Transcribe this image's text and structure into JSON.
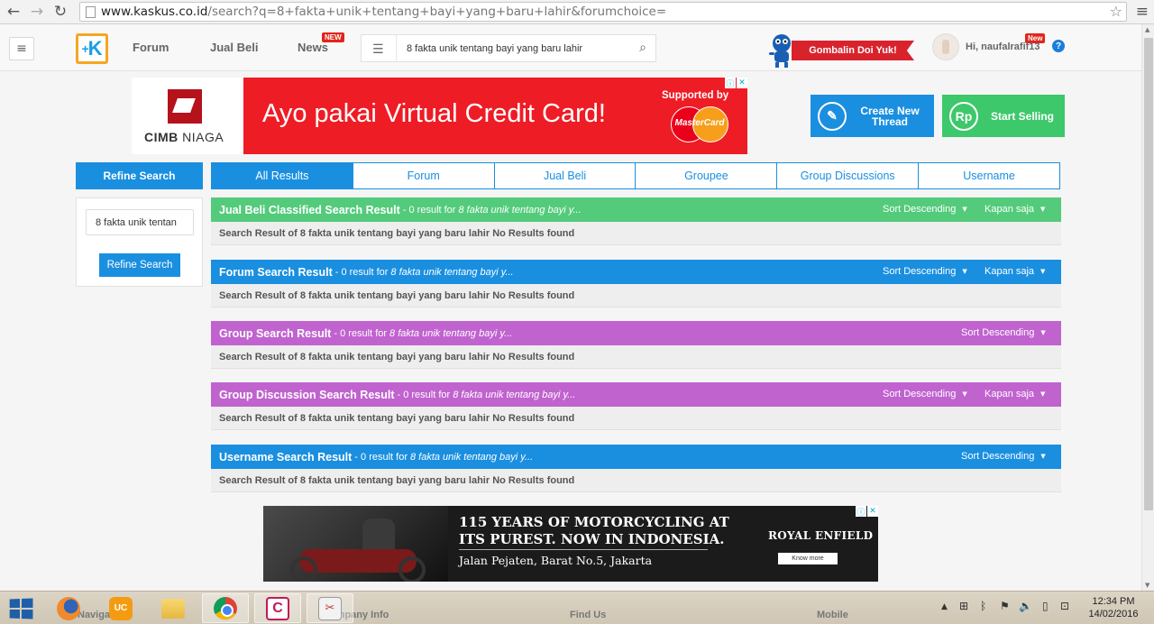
{
  "browser": {
    "url_host": "www.kaskus.co.id",
    "url_path": "/search?q=8+fakta+unik+tentang+bayi+yang+baru+lahir&forumchoice="
  },
  "header": {
    "nav": [
      {
        "label": "Forum"
      },
      {
        "label": "Jual Beli"
      },
      {
        "label": "News",
        "badge": "NEW"
      }
    ],
    "search_value": "8 fakta unik tentang bayi yang baru lahir",
    "promo_label": "Gombalin Doi Yuk!",
    "greeting": "Hi, naufalrafif13",
    "user_badge": "New",
    "help_label": "?"
  },
  "top_ad": {
    "brand": "CIMB",
    "brand_suffix": "NIAGA",
    "headline": "Ayo pakai Virtual Credit Card!",
    "supported": "Supported by",
    "card_brand": "MasterCard"
  },
  "actions": {
    "create_thread": "Create New Thread",
    "start_selling": "Start Selling"
  },
  "refine": {
    "title": "Refine Search",
    "input_value": "8 fakta unik tentan",
    "button": "Refine Search"
  },
  "tabs": [
    {
      "label": "All Results",
      "active": true
    },
    {
      "label": "Forum"
    },
    {
      "label": "Jual Beli"
    },
    {
      "label": "Groupee"
    },
    {
      "label": "Group Discussions"
    },
    {
      "label": "Username"
    }
  ],
  "results": [
    {
      "title": "Jual Beli Classified Search Result",
      "count_text": "- 0 result for",
      "query": "8 fakta unik tentang bayi y...",
      "sort": "Sort Descending",
      "time": "Kapan saja",
      "body": "Search Result of 8 fakta unik tentang bayi yang baru lahir No Results found",
      "color": "#53cb7b"
    },
    {
      "title": "Forum Search Result",
      "count_text": "- 0 result for",
      "query": "8 fakta unik tentang bayi y...",
      "sort": "Sort Descending",
      "time": "Kapan saja",
      "body": "Search Result of 8 fakta unik tentang bayi yang baru lahir No Results found",
      "color": "#1a8fe0"
    },
    {
      "title": "Group Search Result",
      "count_text": "- 0 result for",
      "query": "8 fakta unik tentang bayi y...",
      "sort": "Sort Descending",
      "body": "Search Result of 8 fakta unik tentang bayi yang baru lahir No Results found",
      "color": "#c063cf"
    },
    {
      "title": "Group Discussion Search Result",
      "count_text": "- 0 result for",
      "query": "8 fakta unik tentang bayi y...",
      "sort": "Sort Descending",
      "time": "Kapan saja",
      "body": "Search Result of 8 fakta unik tentang bayi yang baru lahir No Results found",
      "color": "#c063cf"
    },
    {
      "title": "Username Search Result",
      "count_text": "- 0 result for",
      "query": "8 fakta unik tentang bayi y...",
      "sort": "Sort Descending",
      "body": "Search Result of 8 fakta unik tentang bayi yang baru lahir No Results found",
      "color": "#1a8fe0"
    }
  ],
  "bottom_ad": {
    "headline_1": "115 YEARS OF MOTORCYCLING AT",
    "headline_2": "ITS PUREST. NOW IN INDONESIA.",
    "address": "Jalan Pejaten, Barat No.5, Jakarta",
    "brand": "ROYAL ENFIELD",
    "cta": "Know more"
  },
  "footer_peek": {
    "navigation": "Naviga",
    "company": "Company Info",
    "find_us": "Find Us",
    "mobile": "Mobile"
  },
  "taskbar": {
    "uc_label": "UC",
    "time": "12:34 PM",
    "date": "14/02/2016"
  }
}
